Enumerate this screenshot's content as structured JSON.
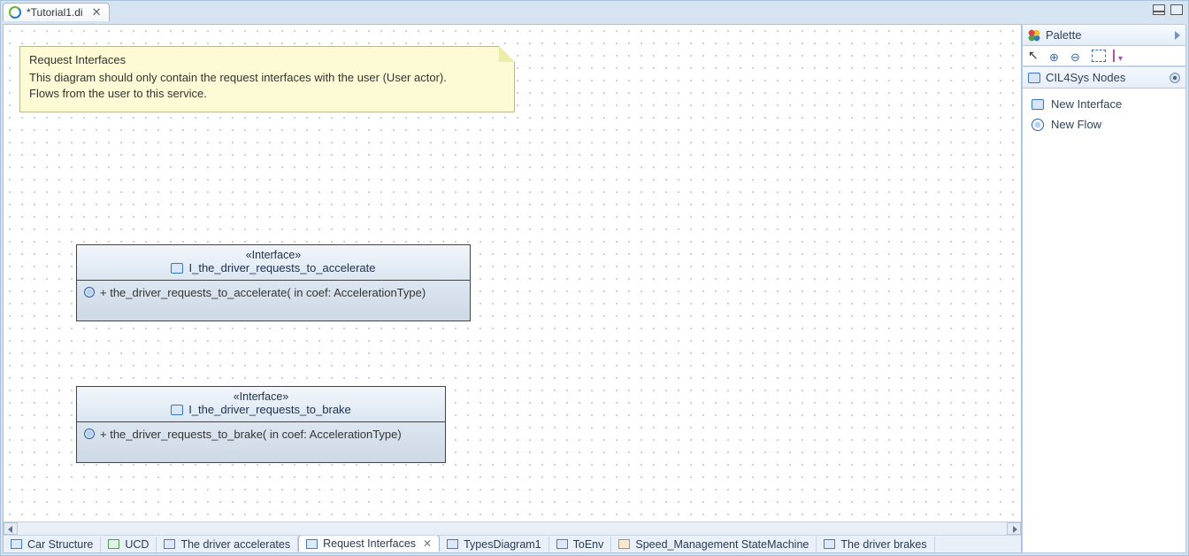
{
  "tab": {
    "title": "*Tutorial1.di"
  },
  "note": {
    "title": "Request Interfaces",
    "line1": "This diagram should only contain the request interfaces with the user (User actor).",
    "line2": "Flows from the user to this service."
  },
  "interfaces": [
    {
      "stereotype": "«Interface»",
      "name": "I_the_driver_requests_to_accelerate",
      "operation": "+ the_driver_requests_to_accelerate(  in coef: AccelerationType)"
    },
    {
      "stereotype": "«Interface»",
      "name": "I_the_driver_requests_to_brake",
      "operation": "+ the_driver_requests_to_brake(  in coef: AccelerationType)"
    }
  ],
  "diagram_tabs": [
    "Car Structure",
    "UCD",
    "The driver accelerates",
    "Request Interfaces",
    "TypesDiagram1",
    "ToEnv",
    "Speed_Management StateMachine",
    "The driver brakes"
  ],
  "palette": {
    "title": "Palette",
    "section": "CIL4Sys Nodes",
    "items": [
      "New Interface",
      "New Flow"
    ]
  }
}
